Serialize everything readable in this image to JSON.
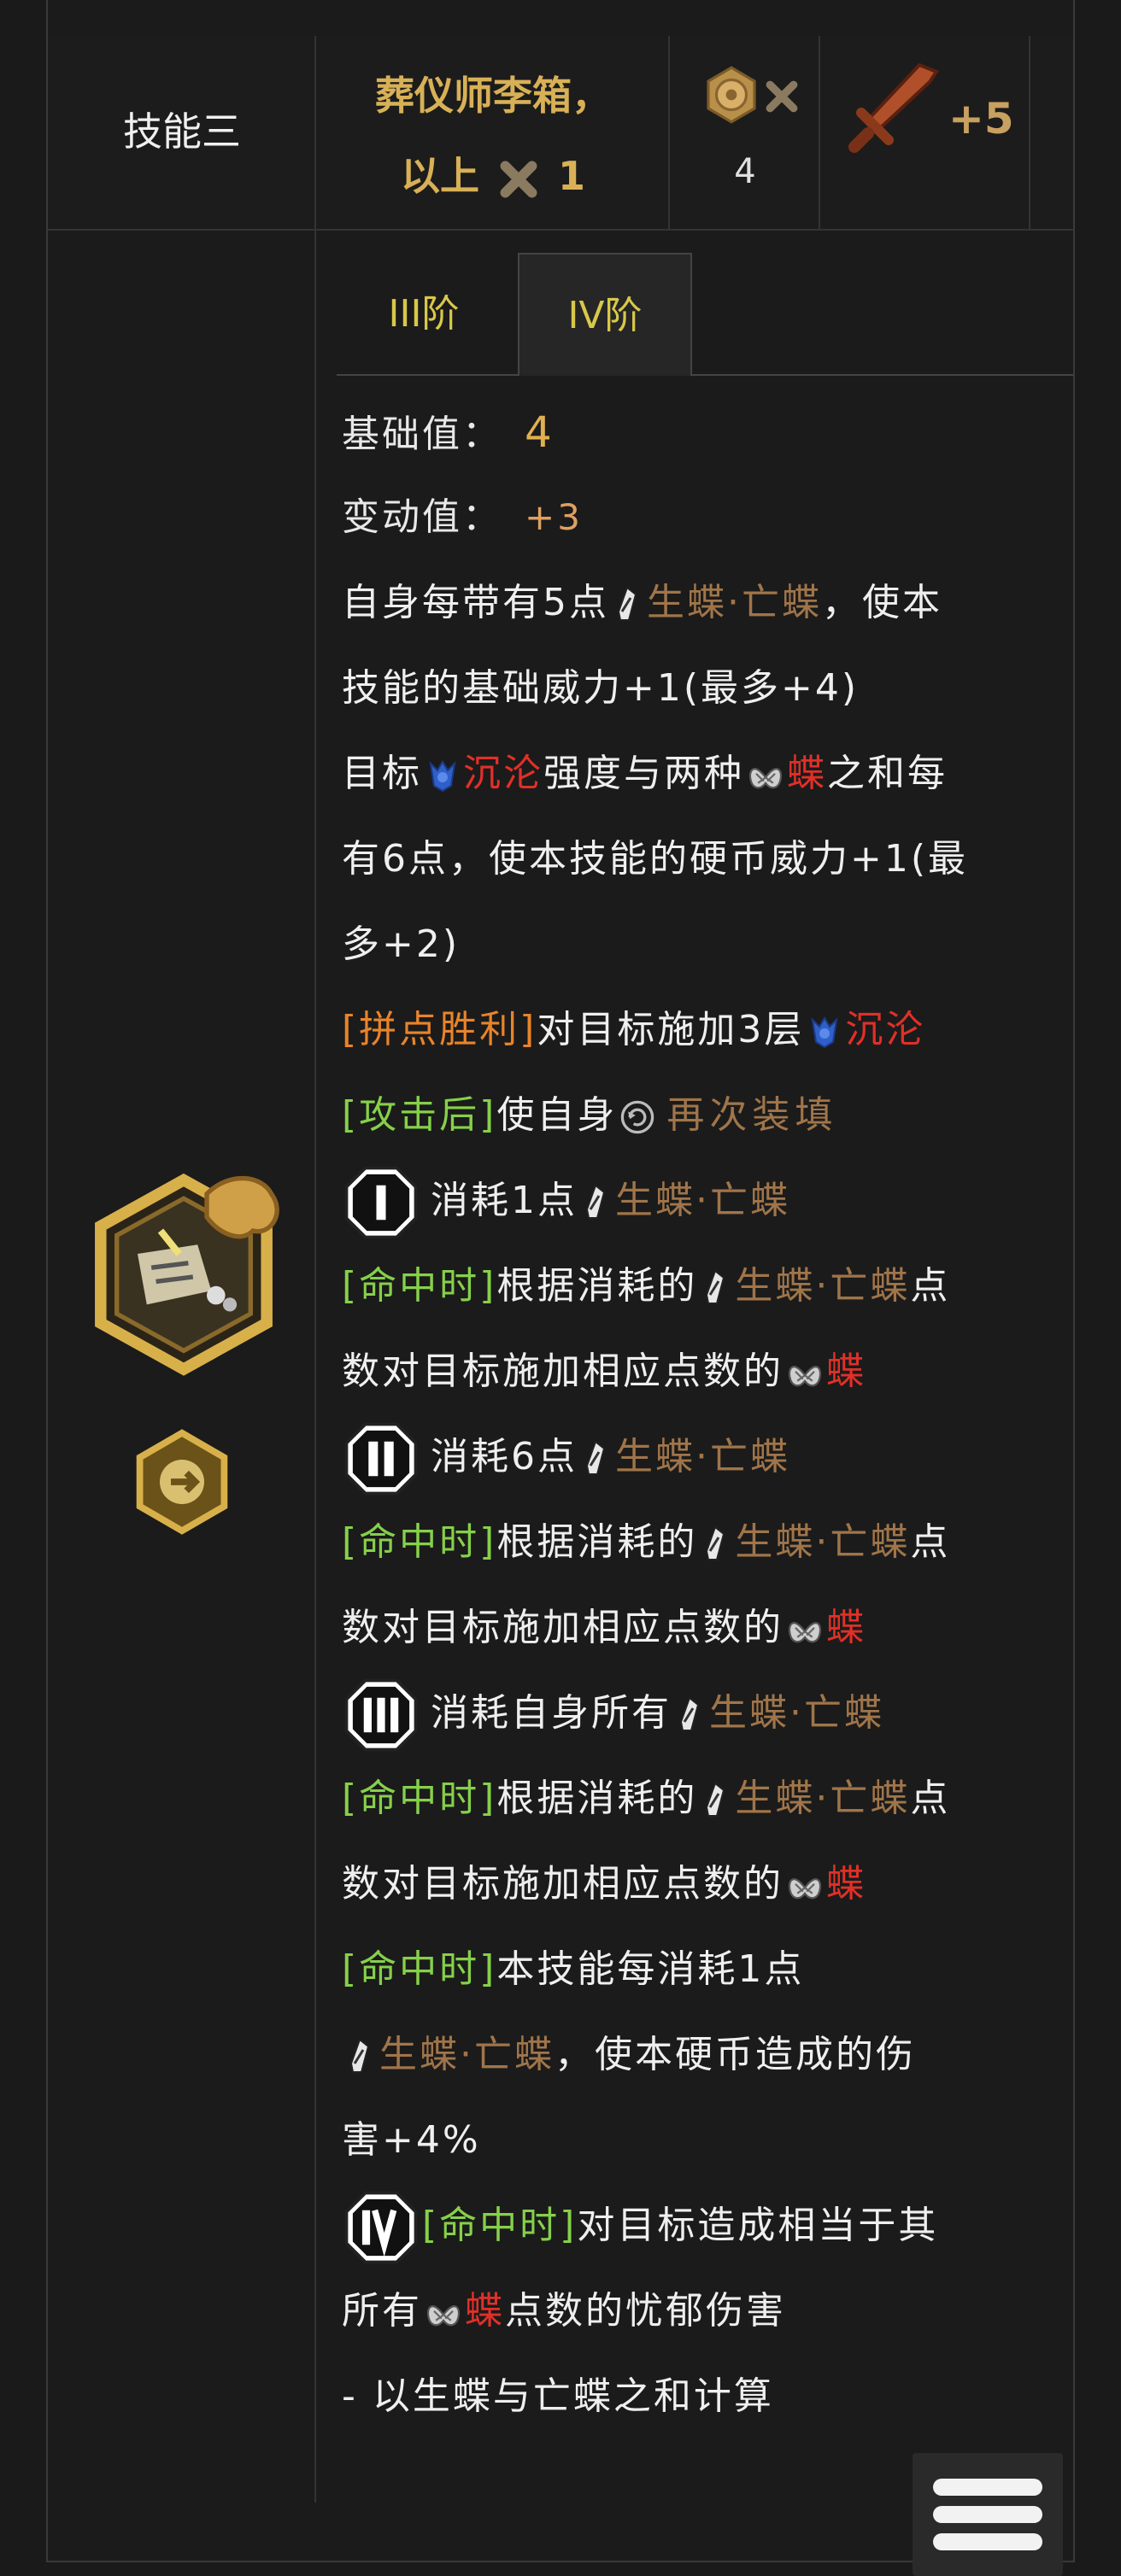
{
  "header": {
    "skill_name": "技能三",
    "condition_line1": "葬仪师李箱，",
    "condition_line2_prefix": "以上",
    "condition_line2_count": "1",
    "cost_value": "4",
    "attack_bonus": "+5"
  },
  "tabs": [
    {
      "label": "III阶",
      "active": false
    },
    {
      "label": "IV阶",
      "active": true
    }
  ],
  "stats": {
    "base_label": "基础值：",
    "base_value": "4",
    "change_label": "变动值：",
    "change_value": "+3"
  },
  "text": {
    "l3a": "自身每带有5点",
    "butterfly_both": "生蝶·亡蝶",
    "l3b": "，使本",
    "l4": "技能的基础威力+1(最多+4)",
    "l5a": "目标",
    "sink": "沉沦",
    "l5b": "强度与两种",
    "butterfly": "蝶",
    "l5c": "之和每",
    "l6": "有6点，使本技能的硬币威力+1(最",
    "l7": "多+2)",
    "clash_tag": "[拼点胜利]",
    "l8a": "对目标施加3层",
    "after_tag": "[攻击后]",
    "l9a": "使自身",
    "reload": "再次装填",
    "l10a": "消耗1点",
    "hit_tag": "[命中时]",
    "l11a": "根据消耗的",
    "l11b": "点",
    "l12a": "数对目标施加相应点数的",
    "l13a": "消耗6点",
    "l16a": "消耗自身所有",
    "l19a": "本技能每消耗1点",
    "l20b": "，使本硬币造成的伤",
    "l21": "害+4%",
    "l22a": "对目标造成相当于其",
    "l23a": "所有",
    "l23b": "点数的忧郁伤害",
    "l24": "- 以生蝶与亡蝶之和计算"
  },
  "colors": {
    "gold": "#d8b056",
    "butterfly_brown": "#a0754a",
    "red": "#e03028",
    "orange": "#e8842a",
    "green": "#86d04a"
  },
  "icons": {
    "cost": "coin-hexagon-icon",
    "sword": "sword-icon",
    "bullet": "bullet-icon",
    "sink": "sink-icon",
    "butterfly": "butterfly-icon",
    "reload": "reload-icon",
    "menu": "hamburger-menu-icon"
  }
}
